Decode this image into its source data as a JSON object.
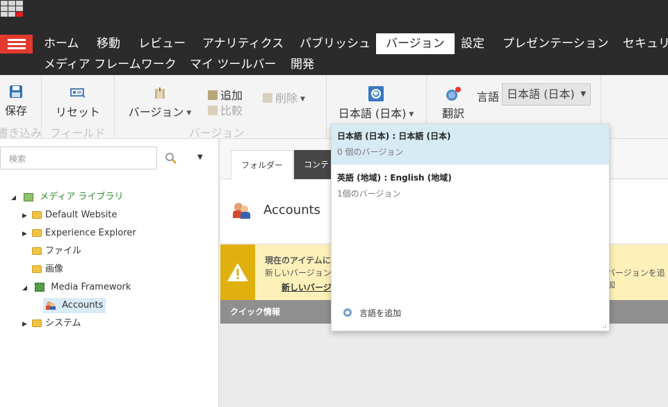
{
  "nav": {
    "row1": [
      "ホーム",
      "移動",
      "レビュー",
      "アナリティクス",
      "パブリッシュ",
      "バージョン",
      "設定",
      "プレゼンテーション",
      "セキュリ"
    ],
    "row2": [
      "メディア フレームワーク",
      "マイ ツールバー",
      "開発"
    ],
    "active_tab": "バージョン"
  },
  "ribbon": {
    "save": "保存",
    "save_group": "書き込み",
    "reset": "リセット",
    "field_group": "フィールド",
    "version": "バージョン",
    "add": "追加",
    "delete": "削除",
    "compare": "比較",
    "version_group": "バージョン",
    "language": "日本語 (日本)",
    "translate": "翻訳",
    "language_label": "言語",
    "language_select_value": "日本語 (日本)"
  },
  "search": {
    "placeholder": "検索"
  },
  "tree": {
    "root": "メディア ライブラリ",
    "default_website": "Default Website",
    "experience_explorer": "Experience Explorer",
    "files": "ファイル",
    "images": "画像",
    "media_framework": "Media Framework",
    "accounts": "Accounts",
    "system": "システム"
  },
  "content": {
    "tab_folder": "フォルダー",
    "tab_content": "コンテ",
    "title": "Accounts",
    "warning_title": "現在のアイテムに",
    "warning_text": "新しいバージョン",
    "warning_link": "新しいバージ",
    "warning_right": "バージョンを追加",
    "quick_info": "クイック情報"
  },
  "dropdown": {
    "items": [
      {
        "title": "日本語 (日本) : 日本語 (日本)",
        "sub": "0 個のバージョン"
      },
      {
        "title": "英語 (地域) : English (地域)",
        "sub": "1個のバージョン"
      }
    ],
    "add_language": "言語を追加"
  },
  "colors": {
    "accent_red": "#e23a2c",
    "dark_bar": "#2b2b2b",
    "tree_green": "#2e8b2e",
    "warning_yellow": "#e0b10e"
  }
}
